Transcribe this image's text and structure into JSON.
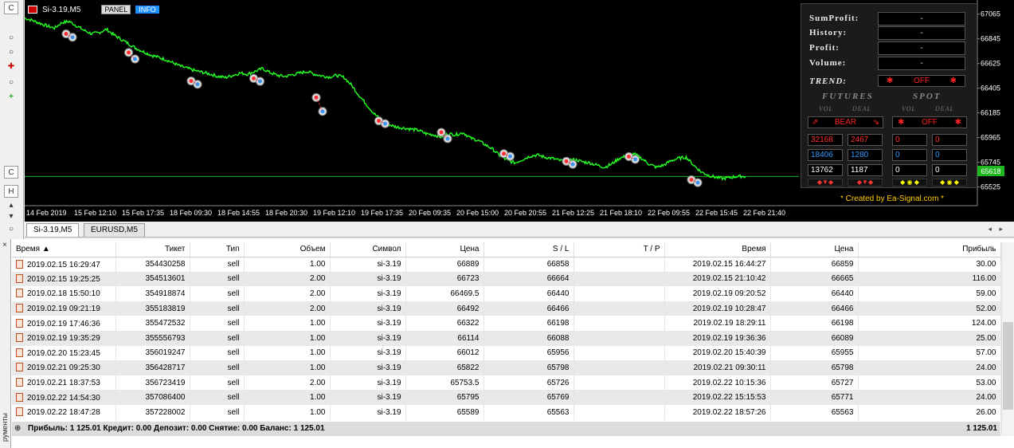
{
  "window": {
    "chart_symbol": "Si-3.19,M5",
    "panel_button": "PANEL",
    "info_button": "INFO"
  },
  "left_toolbar": {
    "labels": [
      "C",
      "H",
      "C"
    ]
  },
  "chart_data": {
    "type": "line",
    "price_ticks": [
      "67065",
      "66845",
      "66625",
      "66405",
      "66185",
      "65965",
      "65745",
      "65525"
    ],
    "price_range": [
      65415,
      67120
    ],
    "current_price_label": "65618",
    "current_price": 65618,
    "time_ticks": [
      "14 Feb 2019",
      "15 Feb 12:10",
      "15 Feb 17:35",
      "18 Feb 09:30",
      "18 Feb 14:55",
      "18 Feb 20:30",
      "19 Feb 12:10",
      "19 Feb 17:35",
      "20 Feb 09:35",
      "20 Feb 15:00",
      "20 Feb 20:55",
      "21 Feb 12:25",
      "21 Feb 18:10",
      "22 Feb 09:55",
      "22 Feb 15:45",
      "22 Feb 21:40"
    ],
    "price_path": [
      67030,
      67010,
      66985,
      66960,
      66940,
      66990,
      67000,
      66960,
      66920,
      66890,
      66900,
      66930,
      66880,
      66840,
      66800,
      66760,
      66730,
      66700,
      66680,
      66660,
      66630,
      66600,
      66580,
      66560,
      66545,
      66530,
      66510,
      66500,
      66520,
      66540,
      66530,
      66555,
      66580,
      66545,
      66520,
      66510,
      66525,
      66540,
      66555,
      66530,
      66515,
      66505,
      66520,
      66500,
      66430,
      66340,
      66260,
      66180,
      66120,
      66080,
      66060,
      66050,
      66040,
      66030,
      66000,
      65990,
      65970,
      66000,
      65990,
      66010,
      65960,
      65940,
      65900,
      65860,
      65800,
      65760,
      65740,
      65770,
      65800,
      65810,
      65790,
      65780,
      65760,
      65760,
      65770,
      65750,
      65740,
      65720,
      65700,
      65730,
      65780,
      65800,
      65820,
      65780,
      65730,
      65700,
      65720,
      65760,
      65780,
      65790,
      65720,
      65660,
      65630,
      65610,
      65600,
      65610,
      65620,
      65618
    ]
  },
  "panel": {
    "rows": [
      {
        "label": "SumProfit:",
        "value": "-"
      },
      {
        "label": "History:",
        "value": "-"
      },
      {
        "label": "Profit:",
        "value": "-"
      },
      {
        "label": "Volume:",
        "value": "-"
      }
    ],
    "trend_label": "TREND:",
    "trend_value": "OFF",
    "futures_header": "FUTURES",
    "spot_header": "SPOT",
    "vol_label": "VOL",
    "deal_label": "DEAL",
    "futures_state": "BEAR",
    "spot_state": "OFF",
    "futures_rows": [
      [
        "32168",
        "2467"
      ],
      [
        "18406",
        "1280"
      ],
      [
        "13762",
        "1187"
      ]
    ],
    "spot_rows": [
      [
        "0",
        "0"
      ],
      [
        "0",
        "0"
      ],
      [
        "0",
        "0"
      ]
    ],
    "star": "✱",
    "credit": "* Created by Ea-Signal.com *",
    "colors": {
      "red": "#ff3030",
      "blue": "#3399ff",
      "white": "#ffffff"
    }
  },
  "chart_tabs": [
    "Si-3.19,M5",
    "EURUSD,M5"
  ],
  "terminal": {
    "columns": [
      "Время",
      "Тикет",
      "Тип",
      "Объем",
      "Символ",
      "Цена",
      "S / L",
      "T / P",
      "Время",
      "Цена",
      "Прибыль"
    ],
    "rows": [
      [
        "2019.02.15 16:29:47",
        "354430258",
        "sell",
        "1.00",
        "si-3.19",
        "66889",
        "66858",
        "",
        "2019.02.15 16:44:27",
        "66859",
        "30.00"
      ],
      [
        "2019.02.15 19:25:25",
        "354513601",
        "sell",
        "2.00",
        "si-3.19",
        "66723",
        "66664",
        "",
        "2019.02.15 21:10:42",
        "66665",
        "116.00"
      ],
      [
        "2019.02.18 15:50:10",
        "354918874",
        "sell",
        "2.00",
        "si-3.19",
        "66469.5",
        "66440",
        "",
        "2019.02.19 09:20:52",
        "66440",
        "59.00"
      ],
      [
        "2019.02.19 09:21:19",
        "355183819",
        "sell",
        "2.00",
        "si-3.19",
        "66492",
        "66466",
        "",
        "2019.02.19 10:28:47",
        "66466",
        "52.00"
      ],
      [
        "2019.02.19 17:46:36",
        "355472532",
        "sell",
        "1.00",
        "si-3.19",
        "66322",
        "66198",
        "",
        "2019.02.19 18:29:11",
        "66198",
        "124.00"
      ],
      [
        "2019.02.19 19:35:29",
        "355556793",
        "sell",
        "1.00",
        "si-3.19",
        "66114",
        "66088",
        "",
        "2019.02.19 19:36:36",
        "66089",
        "25.00"
      ],
      [
        "2019.02.20 15:23:45",
        "356019247",
        "sell",
        "1.00",
        "si-3.19",
        "66012",
        "65956",
        "",
        "2019.02.20 15:40:39",
        "65955",
        "57.00"
      ],
      [
        "2019.02.21 09:25:30",
        "356428717",
        "sell",
        "1.00",
        "si-3.19",
        "65822",
        "65798",
        "",
        "2019.02.21 09:30:11",
        "65798",
        "24.00"
      ],
      [
        "2019.02.21 18:37:53",
        "356723419",
        "sell",
        "2.00",
        "si-3.19",
        "65753.5",
        "65726",
        "",
        "2019.02.22 10:15:36",
        "65727",
        "53.00"
      ],
      [
        "2019.02.22 14:54:30",
        "357086400",
        "sell",
        "1.00",
        "si-3.19",
        "65795",
        "65769",
        "",
        "2019.02.22 15:15:53",
        "65771",
        "24.00"
      ],
      [
        "2019.02.22 18:47:28",
        "357228002",
        "sell",
        "1.00",
        "si-3.19",
        "65589",
        "65563",
        "",
        "2019.02.22 18:57:26",
        "65563",
        "26.00"
      ]
    ],
    "summary": "Прибыль: 1 125.01  Кредит: 0.00  Депозит: 0.00  Снятие: 0.00  Баланс: 1 125.01",
    "total": "1 125.01",
    "side_tab": "рументы"
  }
}
